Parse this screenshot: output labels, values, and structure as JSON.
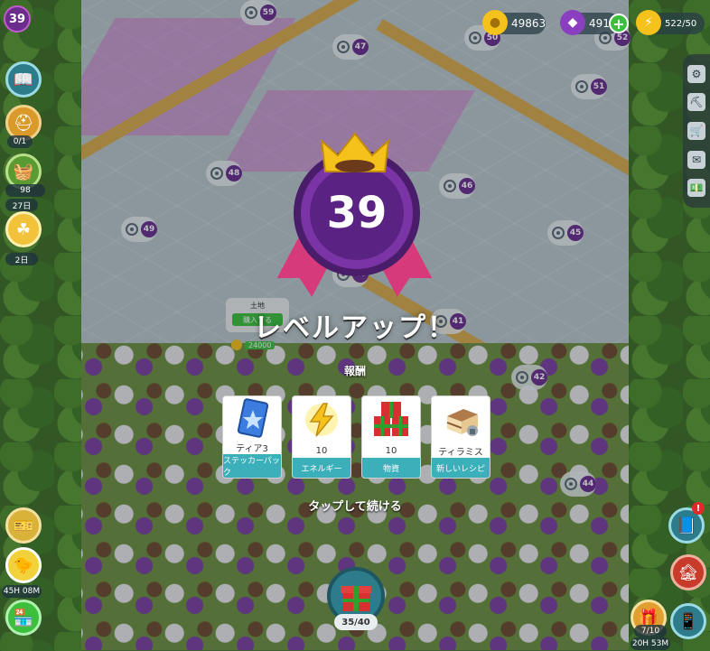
{
  "hud": {
    "player_level": "39",
    "coins": "49863",
    "gems": "491",
    "energy": "522/50"
  },
  "left_panel": {
    "quest_progress": "0/1",
    "basket_count": "98",
    "timer_a": "27日",
    "timer_b": "2日",
    "bottom_timer": "45H 08M"
  },
  "right_panel": {
    "bottom_count": "7/10",
    "bottom_timer": "20H 53M"
  },
  "land_sign": {
    "title": "土地",
    "buy_label": "購入する",
    "price": "24000"
  },
  "locked_plots": [
    "59",
    "47",
    "50",
    "52",
    "51",
    "48",
    "46",
    "49",
    "45",
    "41",
    "42",
    "44",
    "40"
  ],
  "levelup": {
    "level": "39",
    "title": "レベルアップ！",
    "reward_heading": "報酬",
    "tap_to_continue": "タップして続ける",
    "rewards": [
      {
        "qty": "ティア3",
        "caption": "ステッカーパック",
        "icon": "sticker-pack-icon"
      },
      {
        "qty": "10",
        "caption": "エネルギー",
        "icon": "energy-bolt-icon"
      },
      {
        "qty": "10",
        "caption": "物資",
        "icon": "gift-boxes-icon"
      },
      {
        "qty": "ティラミス",
        "caption": "新しいレシピ",
        "icon": "tiramisu-icon"
      }
    ]
  },
  "bottom": {
    "gift_count": "35/40"
  },
  "colors": {
    "medal_purple": "#7b34a5",
    "ribbon_pink": "#d63a7a",
    "caption_teal": "#3bb0bb",
    "crown_gold": "#f5c21b"
  }
}
